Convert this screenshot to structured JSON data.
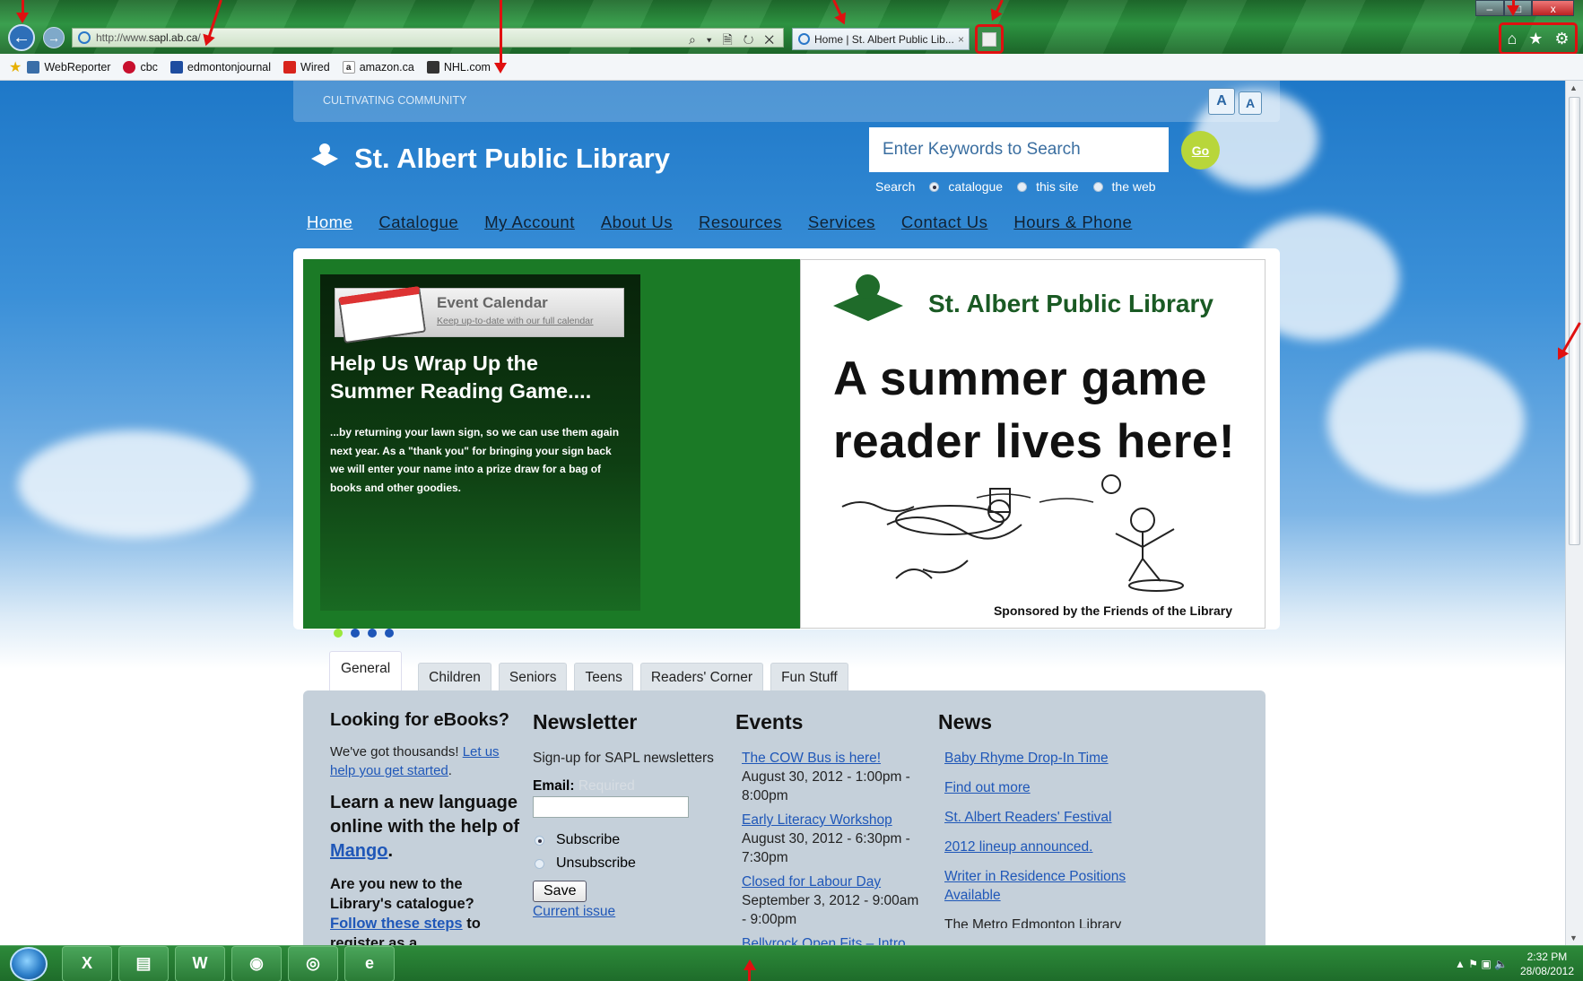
{
  "browser": {
    "url_prefix": "http://www.",
    "url_domain": "sapl.ab.ca",
    "url_suffix": "/",
    "tab_title": "Home | St. Albert Public Lib...",
    "tab_close": "×",
    "address_tools": "⌕ ▾ 🗎 ↻ ✕",
    "window_controls": [
      "–",
      "□",
      "x"
    ],
    "toolbar_icons": [
      "home-icon",
      "star-icon",
      "gear-icon"
    ]
  },
  "favorites": [
    {
      "label": "WebReporter",
      "icon": "page-icon",
      "color": "#3a6ea8"
    },
    {
      "label": "cbc",
      "icon": "cbc-icon",
      "color": "#c8102e"
    },
    {
      "label": "edmontonjournal",
      "icon": "ej-icon",
      "color": "#1e4da0"
    },
    {
      "label": "Wired",
      "icon": "wired-icon",
      "color": "#d8241c"
    },
    {
      "label": "amazon.ca",
      "icon": "amazon-icon",
      "color": "#222222"
    },
    {
      "label": "NHL.com",
      "icon": "nhl-icon",
      "color": "#333333"
    }
  ],
  "site": {
    "tagline": "CULTIVATING COMMUNITY",
    "font_larger": "A",
    "font_smaller": "A",
    "name": "St. Albert Public Library",
    "search_placeholder": "Enter Keywords to Search",
    "go_label": "Go",
    "scope_label": "Search",
    "scope_options": [
      "catalogue",
      "this site",
      "the web"
    ],
    "scope_selected": "catalogue",
    "nav": [
      "Home",
      "Catalogue",
      "My Account",
      "About Us",
      "Resources",
      "Services",
      "Contact Us",
      "Hours & Phone"
    ]
  },
  "slider": {
    "calendar_title": "Event Calendar",
    "calendar_link": "Keep up-to-date with our full calendar",
    "headline": "Help Us Wrap Up the Summer Reading Game....",
    "blurb": "...by returning your lawn sign, so we can use them again next year. As a \"thank you\" for bringing your sign back we will enter your name into a prize draw for a bag of books and other goodies.",
    "dot_count": 4,
    "active_dot": 1,
    "poster_org": "St. Albert Public Library",
    "poster_line1": "A summer game",
    "poster_line2": "reader lives here!",
    "poster_sponsor": "Sponsored by the Friends of the Library"
  },
  "tabs": [
    "General",
    "Children",
    "Seniors",
    "Teens",
    "Readers' Corner",
    "Fun Stuff"
  ],
  "active_tab": "General",
  "general": {
    "ebooks_title": "Looking for eBooks?",
    "ebooks_text": "We've got thousands!",
    "ebooks_link": "Let us help you get started",
    "language_text": "Learn a new language online with the help of",
    "language_link": "Mango",
    "catalogue_text": "Are you new to the Library's catalogue?",
    "catalogue_link": "Follow these steps",
    "catalogue_tail": "to register as a"
  },
  "newsletter": {
    "title": "Newsletter",
    "intro": "Sign-up for SAPL newsletters",
    "email_label": "Email:",
    "email_required": "Required",
    "subscribe": "Subscribe",
    "unsubscribe": "Unsubscribe",
    "save": "Save",
    "current_issue": "Current issue"
  },
  "events": {
    "title": "Events",
    "items": [
      {
        "title": "The COW Bus is here!",
        "when": "August 30, 2012 - 1:00pm - 8:00pm"
      },
      {
        "title": "Early Literacy Workshop",
        "when": "August 30, 2012 - 6:30pm - 7:30pm"
      },
      {
        "title": "Closed for Labour Day",
        "when": "September 3, 2012 - 9:00am - 9:00pm"
      },
      {
        "title": "Bellyrock Open Fits – Intro",
        "when": ""
      }
    ]
  },
  "news": {
    "title": "News",
    "items": [
      "Baby Rhyme Drop-In Time",
      "Find out more",
      "St. Albert Readers' Festival",
      "2012 lineup announced.",
      "Writer in Residence Positions Available"
    ],
    "trailing_text": "The Metro Edmonton Library"
  },
  "taskbar": {
    "apps": [
      "excel-icon",
      "explorer-icon",
      "word-icon",
      "chrome-icon",
      "firefox-icon",
      "ie-icon"
    ],
    "time": "2:32 PM",
    "date": "28/08/2012"
  }
}
